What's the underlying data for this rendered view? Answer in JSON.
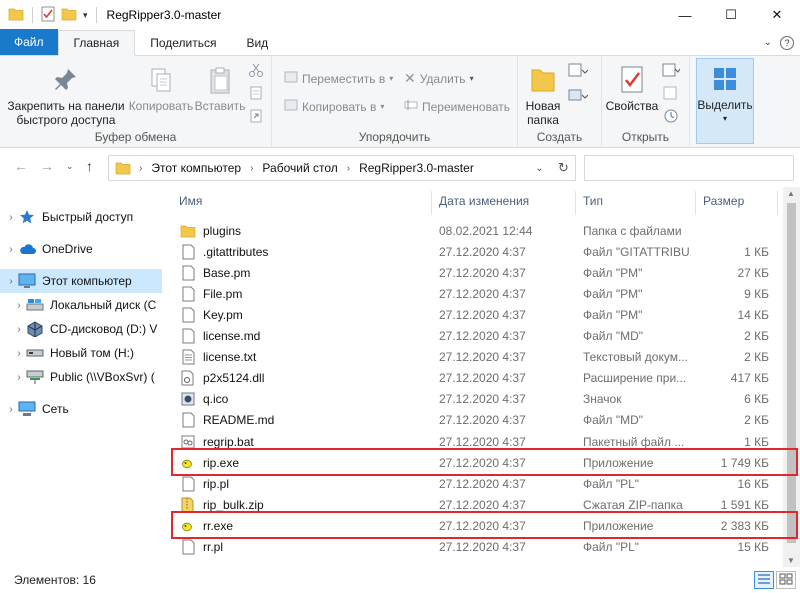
{
  "window": {
    "title": "RegRipper3.0-master",
    "controls": {
      "minimize": "—",
      "maximize": "☐",
      "close": "✕"
    }
  },
  "ribbon_tabs": [
    {
      "label": "Файл"
    },
    {
      "label": "Главная"
    },
    {
      "label": "Поделиться"
    },
    {
      "label": "Вид"
    }
  ],
  "ribbon": {
    "clipboard": {
      "label": "Буфер обмена",
      "pin": "Закрепить на панели быстрого доступа",
      "copy": "Копировать",
      "paste": "Вставить"
    },
    "organize": {
      "label": "Упорядочить",
      "move_to": "Переместить в",
      "copy_to": "Копировать в",
      "delete": "Удалить",
      "rename": "Переименовать"
    },
    "create": {
      "label": "Создать",
      "new_folder": "Новая папка"
    },
    "open": {
      "label": "Открыть",
      "properties": "Свойства"
    },
    "select": {
      "label": "Выделить"
    }
  },
  "address": {
    "crumbs": [
      "Этот компьютер",
      "Рабочий стол",
      "RegRipper3.0-master"
    ],
    "search_placeholder": ""
  },
  "nav_pane": [
    {
      "label": "Быстрый доступ",
      "icon": "star-icon",
      "level": 0
    },
    {
      "label": "OneDrive",
      "icon": "cloud-icon",
      "level": 0
    },
    {
      "label": "Этот компьютер",
      "icon": "computer-icon",
      "level": 0,
      "selected": true
    },
    {
      "label": "Локальный диск (C",
      "icon": "local-disk-icon",
      "level": 1
    },
    {
      "label": "CD-дисковод (D:) V",
      "icon": "cd-drive-icon",
      "level": 1
    },
    {
      "label": "Новый том (H:)",
      "icon": "drive-icon",
      "level": 1
    },
    {
      "label": "Public (\\\\VBoxSvr) (",
      "icon": "network-drive-icon",
      "level": 1
    },
    {
      "label": "Сеть",
      "icon": "network-icon",
      "level": 0
    }
  ],
  "columns": {
    "name": "Имя",
    "date": "Дата изменения",
    "type": "Тип",
    "size": "Размер"
  },
  "files": [
    {
      "name": "plugins",
      "date": "08.02.2021 12:44",
      "type": "Папка с файлами",
      "size": "",
      "icon": "folder-icon"
    },
    {
      "name": ".gitattributes",
      "date": "27.12.2020 4:37",
      "type": "Файл \"GITATTRIBU...",
      "size": "1 КБ",
      "icon": "file-icon"
    },
    {
      "name": "Base.pm",
      "date": "27.12.2020 4:37",
      "type": "Файл \"PM\"",
      "size": "27 КБ",
      "icon": "file-icon"
    },
    {
      "name": "File.pm",
      "date": "27.12.2020 4:37",
      "type": "Файл \"PM\"",
      "size": "9 КБ",
      "icon": "file-icon"
    },
    {
      "name": "Key.pm",
      "date": "27.12.2020 4:37",
      "type": "Файл \"PM\"",
      "size": "14 КБ",
      "icon": "file-icon"
    },
    {
      "name": "license.md",
      "date": "27.12.2020 4:37",
      "type": "Файл \"MD\"",
      "size": "2 КБ",
      "icon": "file-icon"
    },
    {
      "name": "license.txt",
      "date": "27.12.2020 4:37",
      "type": "Текстовый докум...",
      "size": "2 КБ",
      "icon": "text-file-icon"
    },
    {
      "name": "p2x5124.dll",
      "date": "27.12.2020 4:37",
      "type": "Расширение при...",
      "size": "417 КБ",
      "icon": "dll-file-icon"
    },
    {
      "name": "q.ico",
      "date": "27.12.2020 4:37",
      "type": "Значок",
      "size": "6 КБ",
      "icon": "ico-file-icon"
    },
    {
      "name": "README.md",
      "date": "27.12.2020 4:37",
      "type": "Файл \"MD\"",
      "size": "2 КБ",
      "icon": "file-icon"
    },
    {
      "name": "regrip.bat",
      "date": "27.12.2020 4:37",
      "type": "Пакетный файл ...",
      "size": "1 КБ",
      "icon": "bat-file-icon"
    },
    {
      "name": "rip.exe",
      "date": "27.12.2020 4:37",
      "type": "Приложение",
      "size": "1 749 КБ",
      "icon": "exe-file-icon",
      "highlighted": true
    },
    {
      "name": "rip.pl",
      "date": "27.12.2020 4:37",
      "type": "Файл \"PL\"",
      "size": "16 КБ",
      "icon": "file-icon"
    },
    {
      "name": "rip_bulk.zip",
      "date": "27.12.2020 4:37",
      "type": "Сжатая ZIP-папка",
      "size": "1 591 КБ",
      "icon": "zip-file-icon"
    },
    {
      "name": "rr.exe",
      "date": "27.12.2020 4:37",
      "type": "Приложение",
      "size": "2 383 КБ",
      "icon": "exe-file-icon",
      "highlighted": true
    },
    {
      "name": "rr.pl",
      "date": "27.12.2020 4:37",
      "type": "Файл \"PL\"",
      "size": "15 КБ",
      "icon": "file-icon"
    }
  ],
  "status": {
    "items_count": "Элементов: 16"
  },
  "colors": {
    "accent": "#1979ca",
    "highlight": "#e3262c",
    "selected": "#cce8ff",
    "folder": "#f3c84a"
  }
}
